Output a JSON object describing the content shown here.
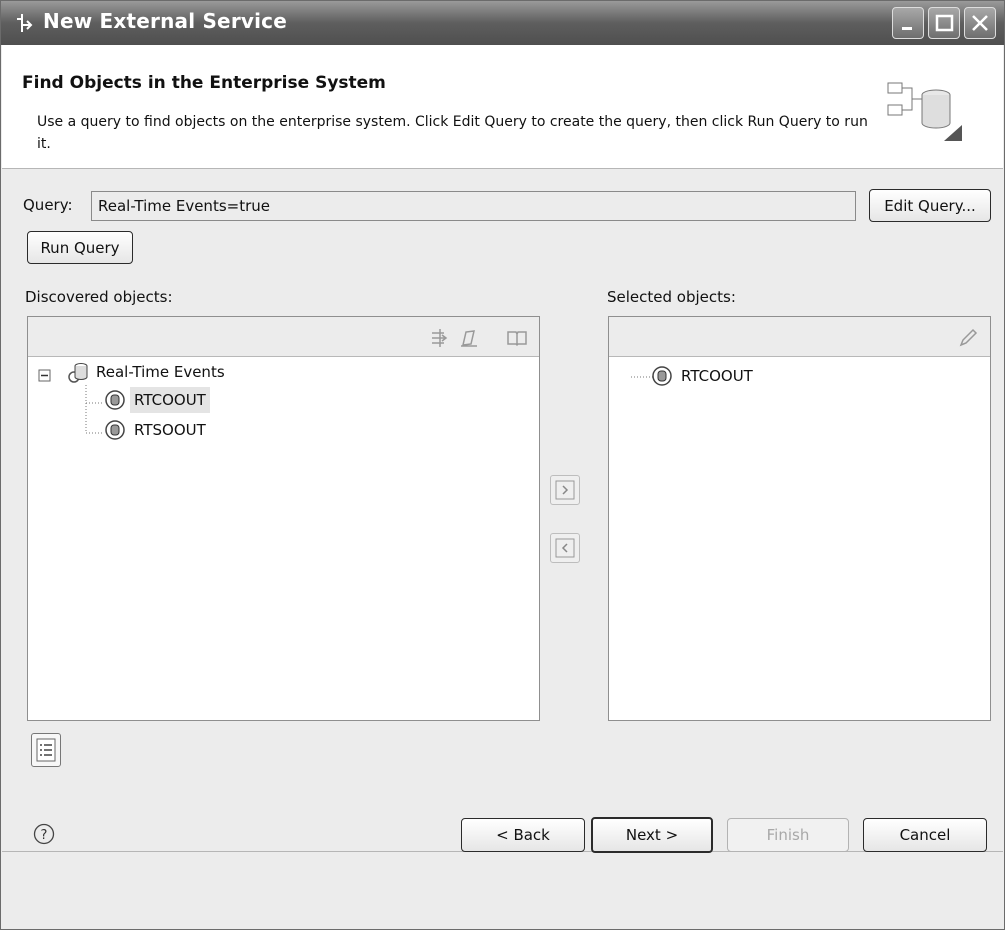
{
  "window": {
    "title": "New External Service"
  },
  "header": {
    "heading": "Find Objects in the Enterprise System",
    "description": "Use a query to find objects on the enterprise system.  Click Edit Query to create the query, then click Run Query to run it."
  },
  "query": {
    "label": "Query:",
    "value": "Real-Time Events=true",
    "edit_button": "Edit Query...",
    "run_button": "Run Query"
  },
  "discovered": {
    "label": "Discovered objects:",
    "tree": {
      "root": "Real-Time Events",
      "children": [
        "RTCOOUT",
        "RTSOOUT"
      ]
    }
  },
  "selected": {
    "label": "Selected objects:",
    "items": [
      "RTCOOUT"
    ]
  },
  "move": {
    "add": ">",
    "remove": "<"
  },
  "footer": {
    "back": "< Back",
    "next": "Next >",
    "finish": "Finish",
    "cancel": "Cancel"
  },
  "icons": {
    "app": "wizard-app-icon",
    "help": "help-icon",
    "properties": "properties-icon",
    "wizard_banner": "enterprise-system-icon",
    "filter": "filter-icon",
    "edit": "edit-icon",
    "book": "book-icon"
  }
}
